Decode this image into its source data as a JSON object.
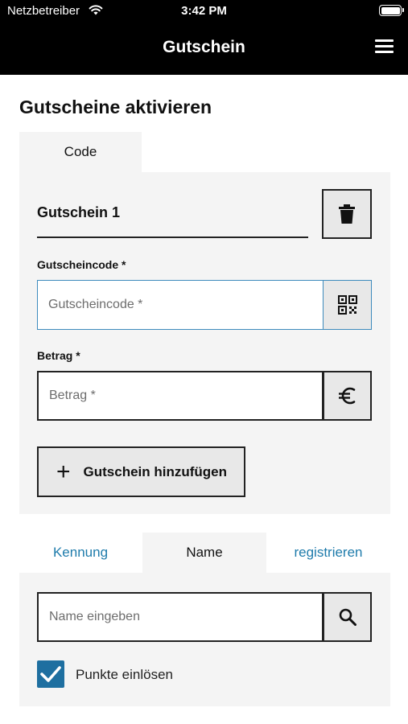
{
  "status_bar": {
    "carrier": "Netzbetreiber",
    "time": "3:42 PM"
  },
  "header": {
    "title": "Gutschein"
  },
  "page": {
    "heading": "Gutscheine aktivieren"
  },
  "voucher_tabs": [
    {
      "label": "Code",
      "active": true
    }
  ],
  "voucher": {
    "name": "Gutschein 1",
    "code_label": "Gutscheincode *",
    "code_placeholder": "Gutscheincode *",
    "code_value": "",
    "amount_label": "Betrag *",
    "amount_placeholder": "Betrag *",
    "amount_value": "",
    "add_button_label": "Gutschein hinzufügen"
  },
  "customer_tabs": [
    {
      "label": "Kennung",
      "active": false
    },
    {
      "label": "Name",
      "active": true
    },
    {
      "label": "registrieren",
      "active": false
    }
  ],
  "customer": {
    "search_placeholder": "Name eingeben",
    "search_value": "",
    "redeem_points_label": "Punkte einlösen",
    "redeem_points_checked": true
  },
  "colors": {
    "header_bg": "#000000",
    "accent": "#1e6fa0",
    "link": "#1e7bab",
    "panel_bg": "#f4f4f4"
  },
  "icons": [
    "wifi-icon",
    "battery-icon",
    "hamburger-menu-icon",
    "trash-icon",
    "qr-code-icon",
    "euro-icon",
    "plus-icon",
    "search-icon",
    "checkmark-icon"
  ]
}
